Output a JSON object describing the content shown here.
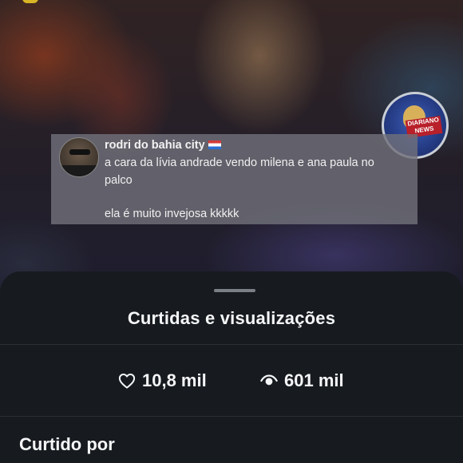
{
  "comment": {
    "username": "rodri do bahia city",
    "flag": "flag-icon",
    "line1": "a cara da lívia andrade vendo milena e ana paula no",
    "line2": "palco",
    "line3": "ela é muito invejosa kkkkk"
  },
  "channel_logo": {
    "text": "DIARIANO NEWS"
  },
  "sheet": {
    "title": "Curtidas e visualizações",
    "likes": "10,8 mil",
    "views": "601 mil",
    "liked_by_label": "Curtido por"
  },
  "colors": {
    "sheet_background": "#171b20",
    "divider": "#2b3036",
    "text": "#f5f6f7"
  }
}
